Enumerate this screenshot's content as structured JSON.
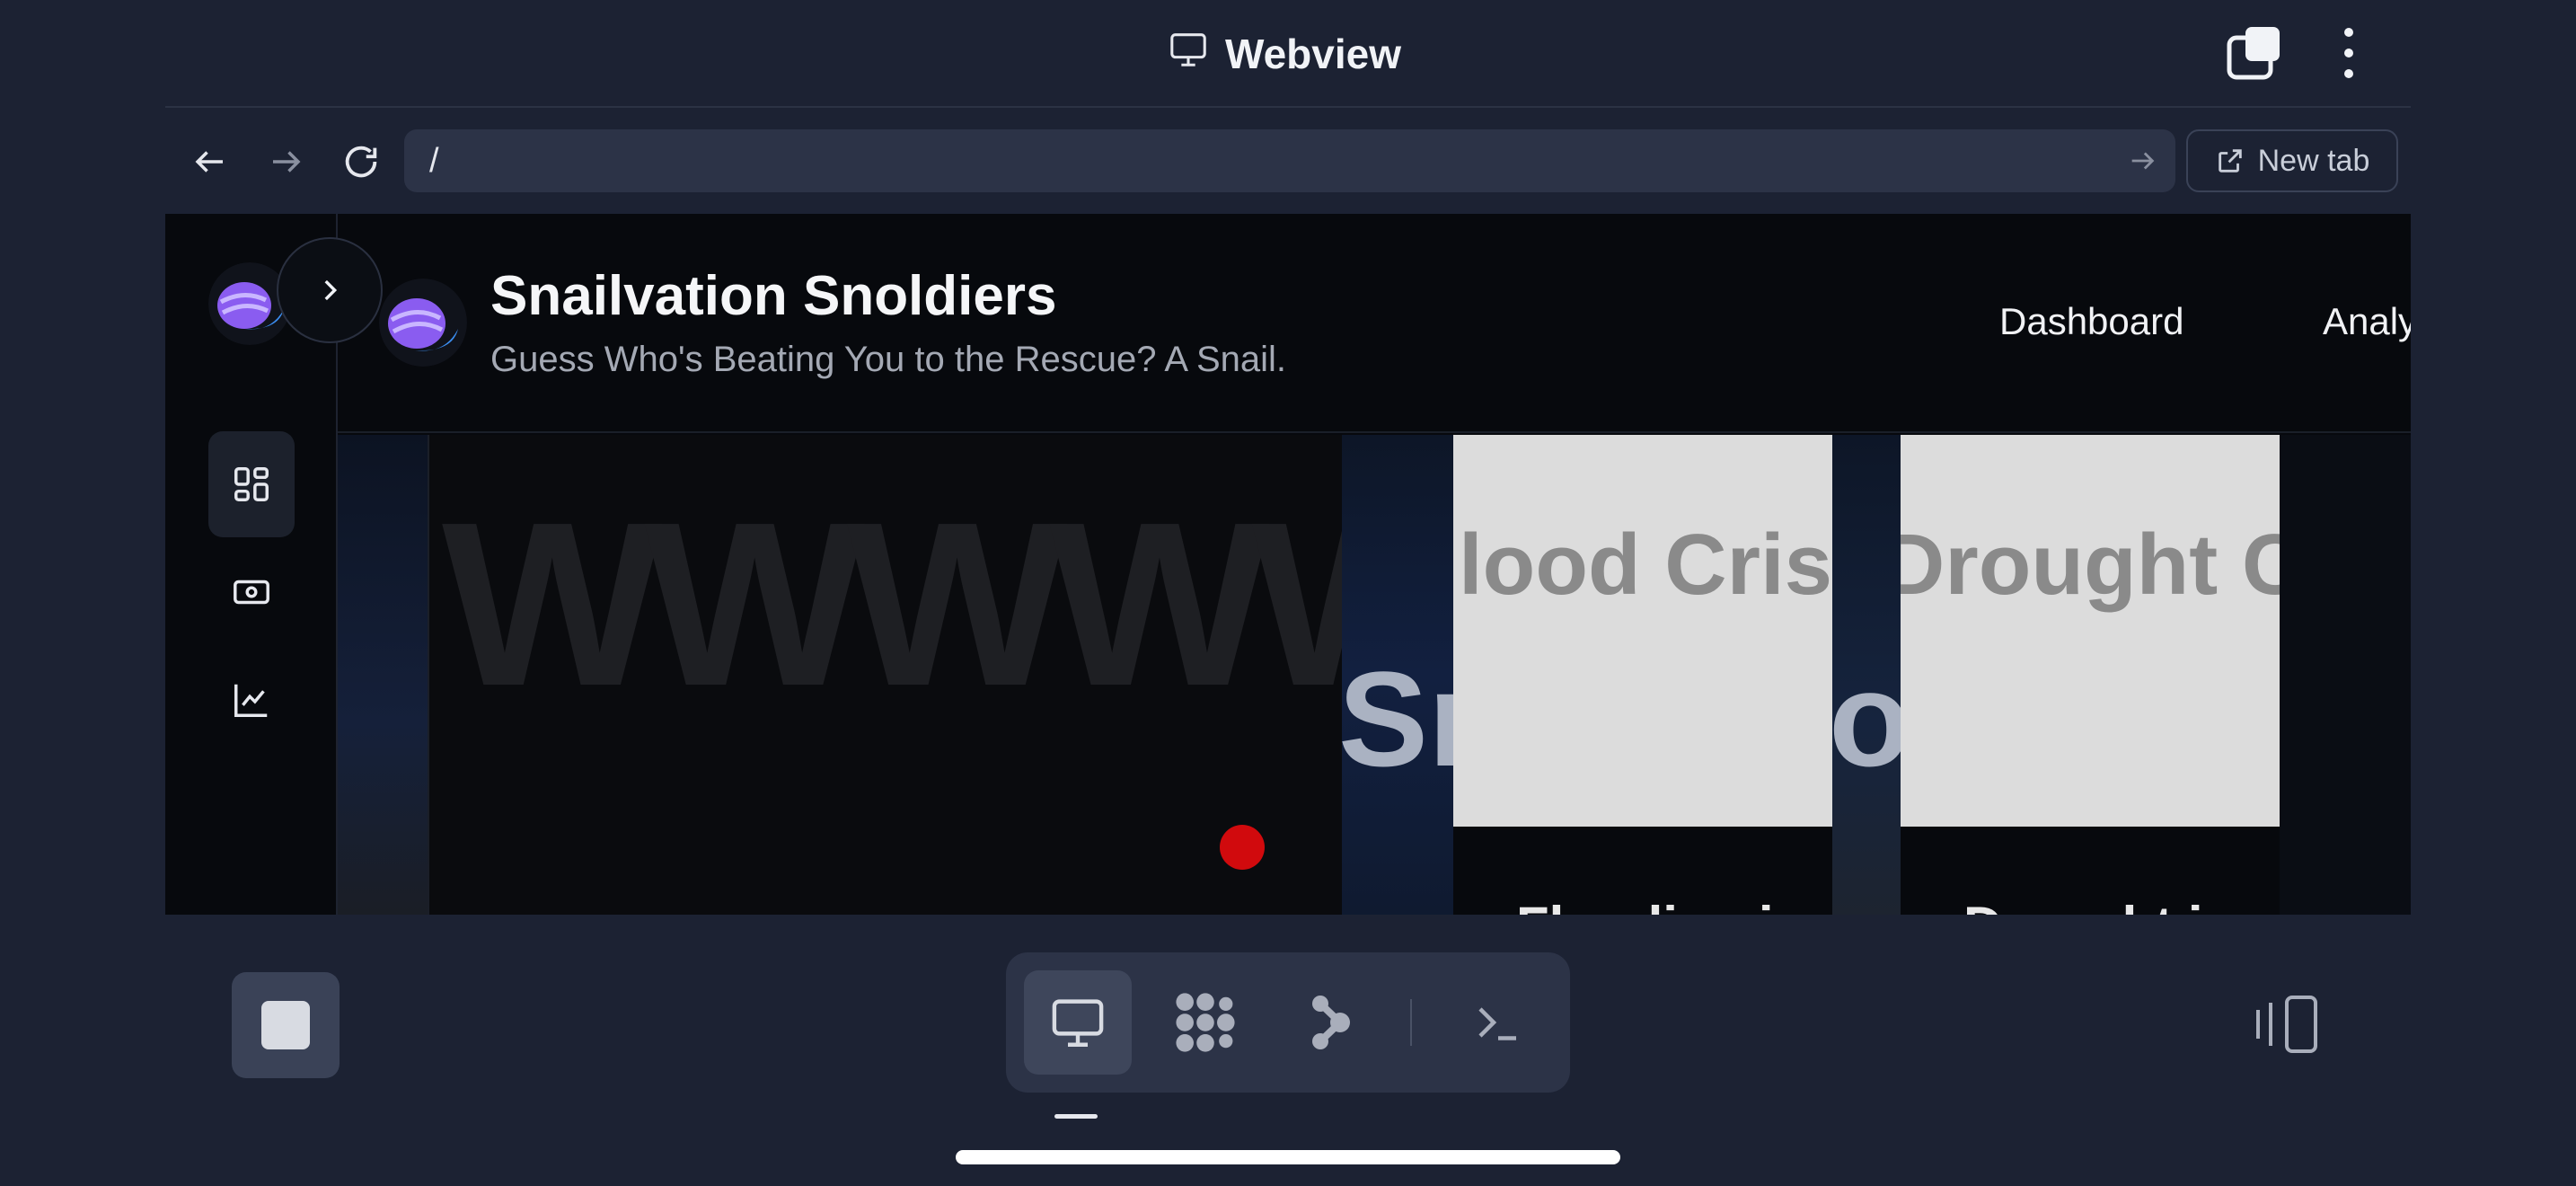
{
  "titlebar": {
    "title": "Webview",
    "title_icon": "monitor-icon"
  },
  "urlbar": {
    "value": "/",
    "new_tab_label": "New tab"
  },
  "site": {
    "title": "Snailvation Snoldiers",
    "subtitle": "Guess Who's Beating You to the Rescue? A Snail.",
    "nav": [
      "Dashboard",
      "Analytics"
    ]
  },
  "content": {
    "main_panel_text": "WWWWW",
    "strip_b_text": "Sr",
    "strip_c_text": "oc",
    "cards": [
      {
        "image_text": "lood Crisi",
        "caption": "Flooding i"
      },
      {
        "image_text": "Drought Crisi",
        "caption": "Drought i"
      }
    ]
  },
  "colors": {
    "background": "#1c2233",
    "webview": "#07090d",
    "accent_red": "#d10a0d"
  }
}
